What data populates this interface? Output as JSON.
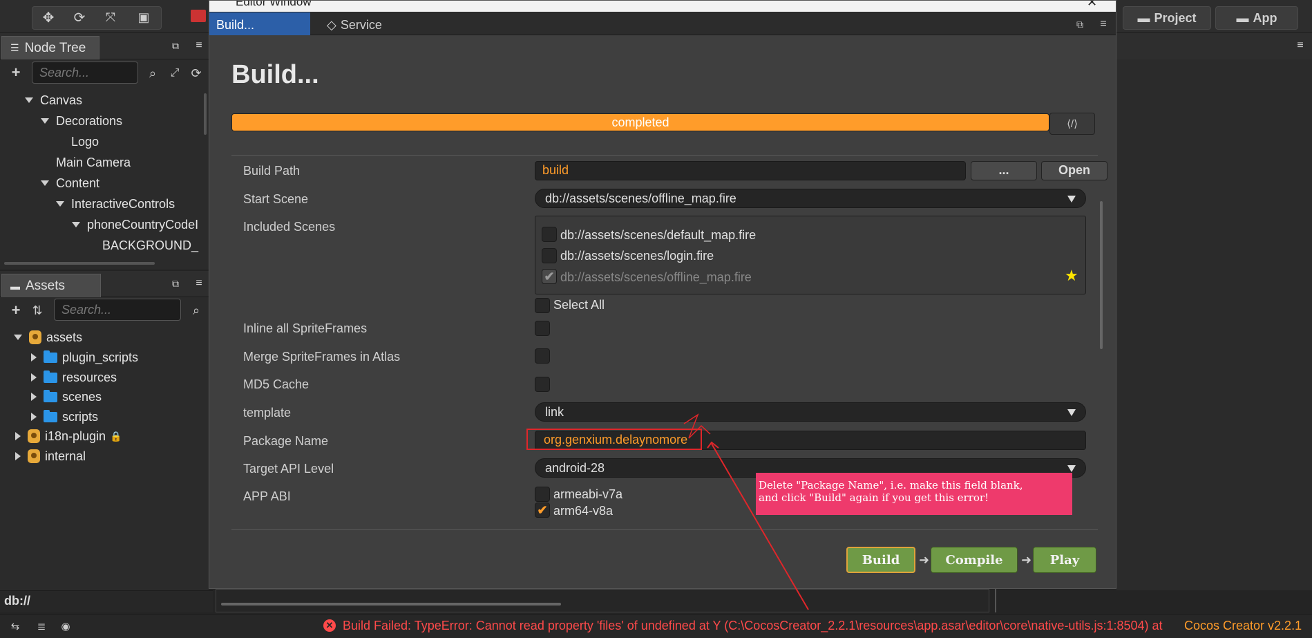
{
  "toolbar": {
    "project_label": "Project",
    "app_label": "App"
  },
  "dialog": {
    "window_title": "Editor Window",
    "tabs": [
      {
        "label": "Build..."
      },
      {
        "label": "Service"
      }
    ],
    "heading": "Build...",
    "progress": {
      "text": "completed",
      "value": 1.0
    },
    "build_path": {
      "label": "Build Path",
      "value": "build",
      "browse_label": "...",
      "open_label": "Open"
    },
    "start_scene": {
      "label": "Start Scene",
      "value": "db://assets/scenes/offline_map.fire"
    },
    "included_scenes": {
      "label": "Included Scenes",
      "items": [
        "db://assets/scenes/default_map.fire",
        "db://assets/scenes/login.fire",
        "db://assets/scenes/offline_map.fire"
      ],
      "select_all": "Select All"
    },
    "inline_sprites": {
      "label": "Inline all SpriteFrames"
    },
    "merge_sprites": {
      "label": "Merge SpriteFrames in Atlas"
    },
    "md5": {
      "label": "MD5 Cache"
    },
    "template": {
      "label": "template",
      "value": "link"
    },
    "package_name": {
      "label": "Package Name",
      "value": "org.genxium.delaynomore"
    },
    "target_api": {
      "label": "Target API Level",
      "value": "android-28"
    },
    "app_abi": {
      "label": "APP ABI",
      "options": [
        "armeabi-v7a",
        "arm64-v8a"
      ]
    },
    "buttons": {
      "build": "Build",
      "compile": "Compile",
      "play": "Play"
    }
  },
  "annotation": {
    "line1": "Delete \"Package Name\", i.e. make this field blank,",
    "line2": "and click \"Build\" again if you get this error!"
  },
  "node_tree": {
    "title": "Node Tree",
    "search_placeholder": "Search...",
    "items": [
      "Canvas",
      "Decorations",
      "Logo",
      "Main Camera",
      "Content",
      "InteractiveControls",
      "phoneCountryCodeI",
      "BACKGROUND_"
    ]
  },
  "assets": {
    "title": "Assets",
    "search_placeholder": "Search...",
    "items": [
      "assets",
      "plugin_scripts",
      "resources",
      "scenes",
      "scripts",
      "i18n-plugin",
      "internal"
    ],
    "path": "db://"
  },
  "status": {
    "error": "Build Failed: TypeError: Cannot read property 'files' of undefined at Y (C:\\CocosCreator_2.2.1\\resources\\app.asar\\editor\\core\\native-utils.js:1:8504) at",
    "version": "Cocos Creator v2.2.1"
  },
  "colors": {
    "accent": "#ff9c2a",
    "error": "#ff4a4a",
    "annotation": "#ee3a6c"
  }
}
